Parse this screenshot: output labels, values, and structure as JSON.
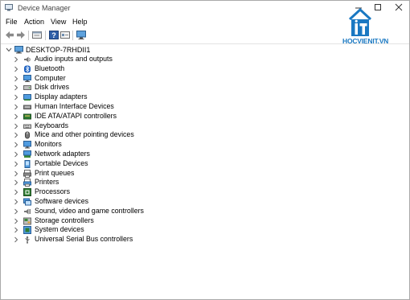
{
  "window": {
    "title": "Device Manager",
    "controls": {
      "minimize": "minimize",
      "maximize": "maximize",
      "close": "close"
    }
  },
  "menu": [
    "File",
    "Action",
    "View",
    "Help"
  ],
  "toolbar": {
    "icons": [
      "back-icon",
      "forward-icon",
      "properties-icon",
      "help-icon",
      "view-icon",
      "monitor-icon"
    ]
  },
  "logo": {
    "text": "HOCVIENIT.VN",
    "color": "#1a78c2"
  },
  "tree": {
    "root": "DESKTOP-7RHDII1",
    "categories": [
      {
        "label": "Audio inputs and outputs",
        "icon": "speaker-icon"
      },
      {
        "label": "Bluetooth",
        "icon": "bluetooth-icon"
      },
      {
        "label": "Computer",
        "icon": "computer-icon"
      },
      {
        "label": "Disk drives",
        "icon": "disk-drive-icon"
      },
      {
        "label": "Display adapters",
        "icon": "display-adapter-icon"
      },
      {
        "label": "Human Interface Devices",
        "icon": "hid-icon"
      },
      {
        "label": "IDE ATA/ATAPI controllers",
        "icon": "ide-controller-icon"
      },
      {
        "label": "Keyboards",
        "icon": "keyboard-icon"
      },
      {
        "label": "Mice and other pointing devices",
        "icon": "mouse-icon"
      },
      {
        "label": "Monitors",
        "icon": "monitor-icon"
      },
      {
        "label": "Network adapters",
        "icon": "network-adapter-icon"
      },
      {
        "label": "Portable Devices",
        "icon": "portable-device-icon"
      },
      {
        "label": "Print queues",
        "icon": "print-queue-icon"
      },
      {
        "label": "Printers",
        "icon": "printer-icon"
      },
      {
        "label": "Processors",
        "icon": "processor-icon"
      },
      {
        "label": "Software devices",
        "icon": "software-device-icon"
      },
      {
        "label": "Sound, video and game controllers",
        "icon": "sound-controller-icon"
      },
      {
        "label": "Storage controllers",
        "icon": "storage-controller-icon"
      },
      {
        "label": "System devices",
        "icon": "system-device-icon"
      },
      {
        "label": "Universal Serial Bus controllers",
        "icon": "usb-icon"
      }
    ]
  }
}
